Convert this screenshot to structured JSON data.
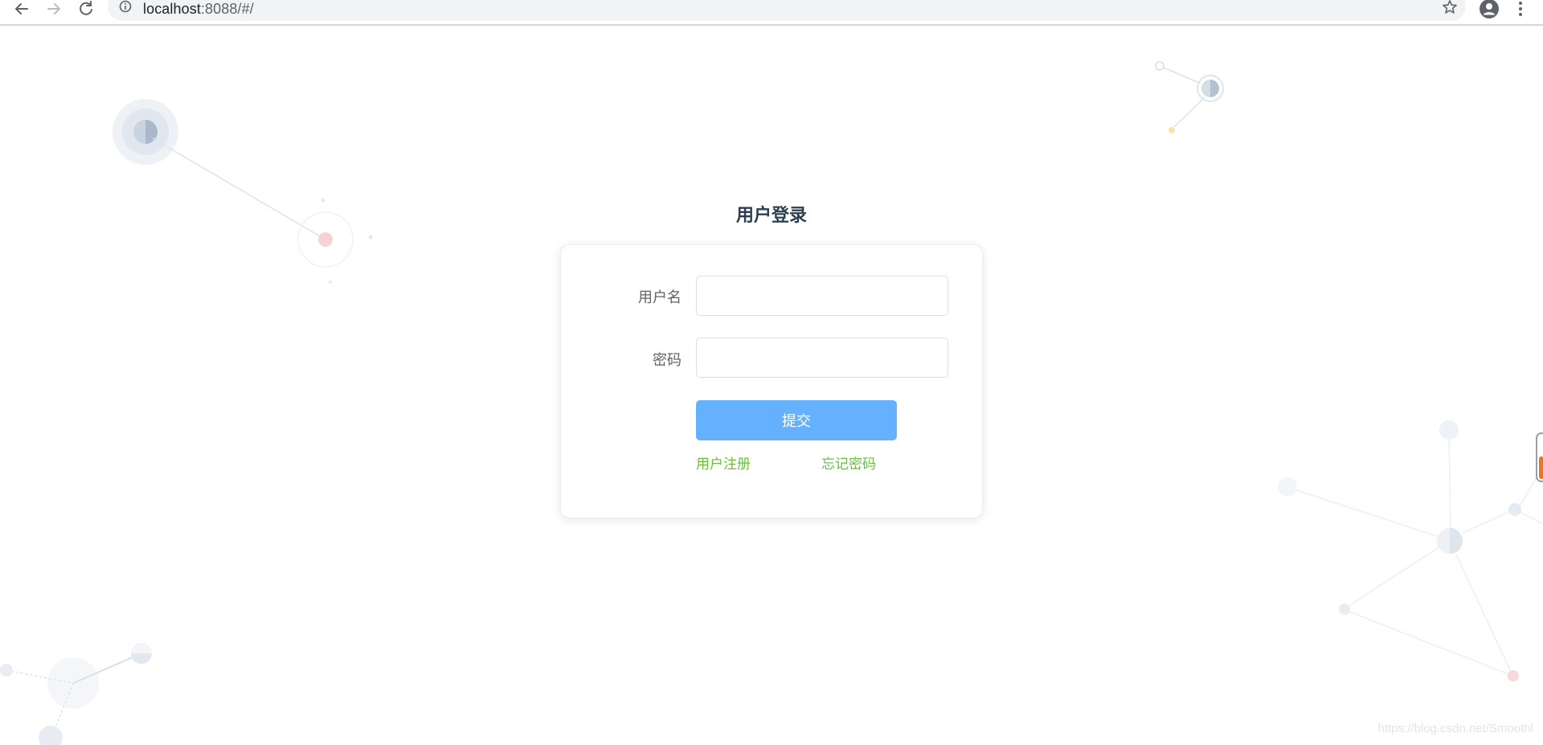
{
  "browser": {
    "url_host": "localhost",
    "url_rest": ":8088/#/"
  },
  "login": {
    "title": "用户登录",
    "username_label": "用户名",
    "username_value": "",
    "password_label": "密码",
    "password_value": "",
    "submit_label": "提交",
    "register_link": "用户注册",
    "forgot_link": "忘记密码"
  },
  "watermark": "https://blog.csdn.net/Smoothl",
  "colors": {
    "primary_button": "#66b1ff",
    "link": "#67c23a",
    "title": "#2c3e50"
  }
}
